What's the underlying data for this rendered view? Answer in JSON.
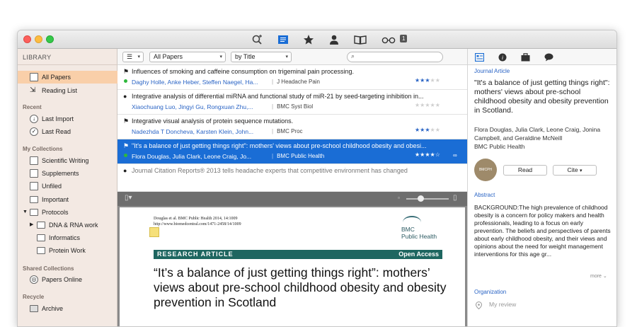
{
  "toolbar": {
    "icons": [
      "search-add-icon",
      "papers-view-icon",
      "favorites-star-icon",
      "person-icon",
      "book-icon",
      "glasses-icon"
    ],
    "badge": "1"
  },
  "sidebar": {
    "header": "LIBRARY",
    "items": [
      {
        "label": "All Papers",
        "icon": "papers-icon"
      },
      {
        "label": "Reading List",
        "icon": "reading-list-icon"
      },
      {
        "section": "Recent"
      },
      {
        "label": "Last Import",
        "icon": "import-icon"
      },
      {
        "label": "Last Read",
        "icon": "check-icon"
      },
      {
        "section": "My Collections"
      },
      {
        "label": "Scientific Writing",
        "icon": "smart-folder-icon"
      },
      {
        "label": "Supplements",
        "icon": "smart-folder-icon"
      },
      {
        "label": "Unfiled",
        "icon": "smart-folder-icon"
      },
      {
        "label": "Important",
        "icon": "folder-icon"
      },
      {
        "label": "Protocols",
        "icon": "folder-icon"
      },
      {
        "label": "DNA & RNA work",
        "icon": "folder-icon"
      },
      {
        "label": "Informatics",
        "icon": "folder-icon"
      },
      {
        "label": "Protein Work",
        "icon": "folder-icon"
      },
      {
        "section": "Shared Collections"
      },
      {
        "label": "Papers Online",
        "icon": "globe-icon"
      },
      {
        "section": "Recycle"
      },
      {
        "label": "Archive",
        "icon": "archive-icon"
      }
    ]
  },
  "listbar": {
    "filter": "All Papers",
    "sort": "by Title",
    "search_placeholder": ""
  },
  "papers": [
    {
      "title": "Influences of smoking and caffeine consumption on trigeminal pain processing.",
      "authors": "Daghy Holle, Anke Heber, Steffen Naegel, Ha...",
      "journal": "J Headache Pain",
      "stars": 3
    },
    {
      "title": "Integrative analysis of differential miRNA and functional study of miR-21 by seed-targeting inhibition in...",
      "authors": "Xiaochuang Luo, Jingyi Gu, Rongxuan Zhu,...",
      "journal": "BMC Syst Biol",
      "stars": 0
    },
    {
      "title": "Integrative visual analysis of protein sequence mutations.",
      "authors": "Nadezhda T Doncheva, Karsten Klein, John...",
      "journal": "BMC Proc",
      "stars": 3
    },
    {
      "title": "\"It's a balance of just getting things right\": mothers' views about pre-school childhood obesity and obesi...",
      "authors": "Flora Douglas, Julia Clark, Leone Craig, Jo...",
      "journal": "BMC Public Health",
      "stars": 4
    },
    {
      "title": "Journal Citation Reports® 2013 tells headache experts that competitive environment has changed",
      "authors": "",
      "journal": "",
      "stars": 0
    }
  ],
  "pdf": {
    "citation_line1": "Douglas et al. BMC Public Health 2014, 14:1009",
    "citation_line2": "http://www.biomedcentral.com/1471-2458/14/1009",
    "brand_line1": "BMC",
    "brand_line2": "Public Health",
    "banner_left": "RESEARCH ARTICLE",
    "banner_right": "Open Access",
    "headline": "“It’s a balance of just getting things right”: mothers’ views about pre-school childhood obesity and obesity prevention in Scotland"
  },
  "details": {
    "type": "Journal Article",
    "title": "\"It's a balance of just getting things right\": mothers' views about pre-school childhood obesity and obesity prevention in Scotland.",
    "authors": "Flora Douglas, Julia Clark, Leone Craig, Jonina Campbell, and Geraldine McNeill",
    "journal": "BMC Public Health",
    "logo_text": "BMCPH",
    "read_button": "Read",
    "cite_button": "Cite",
    "abstract_heading": "Abstract",
    "abstract": "BACKGROUND:The high prevalence of childhood obesity is a concern for policy makers and health professionals, leading to a focus on early prevention. The beliefs and perspectives of parents about early childhood obesity, and their views and opinions about the need for weight management interventions for this age gr...",
    "more": "more",
    "organization_heading": "Organization",
    "review_placeholder": "My review"
  }
}
